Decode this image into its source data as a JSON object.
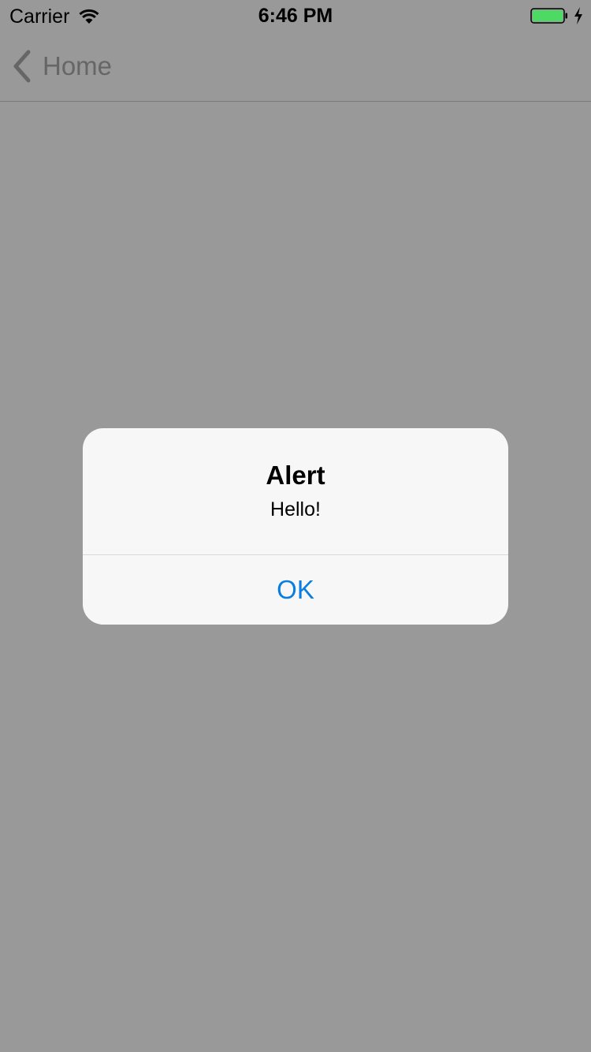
{
  "status_bar": {
    "carrier": "Carrier",
    "time": "6:46 PM",
    "icons": {
      "signal": "wifi-icon",
      "battery": "battery-icon",
      "charging": "charging-bolt-icon"
    },
    "battery_level": 1.0,
    "battery_color": "#4cd964"
  },
  "nav": {
    "back_label": "Home",
    "back_icon": "chevron-left-icon"
  },
  "alert": {
    "title": "Alert",
    "message": "Hello!",
    "button_label": "OK",
    "button_color": "#0a7ee0"
  }
}
